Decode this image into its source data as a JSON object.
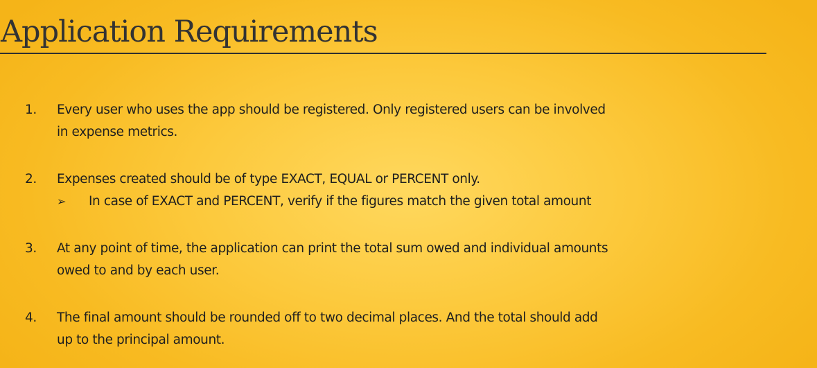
{
  "slide": {
    "title": "Application Requirements",
    "requirements": [
      {
        "number": "1.",
        "lines": [
          "Every user who uses the app should be registered. Only registered users can be involved",
          "in expense metrics."
        ]
      },
      {
        "number": "2.",
        "lines": [
          "Expenses created should be of type EXACT, EQUAL or PERCENT only."
        ],
        "sub_bullet": "➢",
        "sub_text": "In case of EXACT and PERCENT, verify if the figures match the given total amount"
      },
      {
        "number": "3.",
        "lines": [
          "At any point of time, the application can print the total sum owed and individual amounts",
          "owed to and by each user."
        ]
      },
      {
        "number": "4.",
        "lines": [
          "The final amount should be rounded off to two decimal places. And the total should add",
          "up to the principal amount."
        ]
      }
    ]
  }
}
